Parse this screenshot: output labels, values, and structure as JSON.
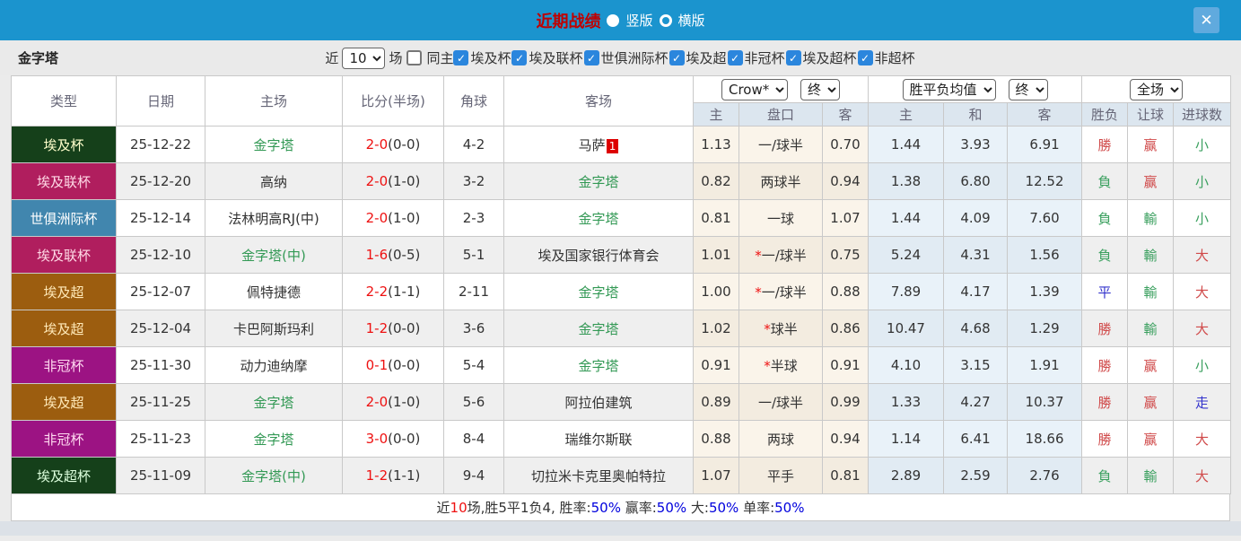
{
  "colors": {
    "titlebar_blue": "#1b94ce",
    "close_button_blue": "#60aade",
    "title_red": "#c00000",
    "header_cell_bg": "#dce6ef",
    "handicap_tint": "#faf4ea",
    "odds_tint": "#e9f2f9",
    "team_green": "#339955",
    "score_red": "#ee1111",
    "result_red": "#d04a4a",
    "result_green": "#3ba05f",
    "result_blue": "#3333cc",
    "footer_blue": "#0000dd",
    "badge_red": "#dd0000",
    "checkbox_blue": "#2b86dd"
  },
  "icons": {
    "close_glyph": "✕",
    "check_glyph": "✓",
    "star_glyph": "*"
  },
  "titlebar": {
    "title": "近期战绩",
    "radio_vertical": "竖版",
    "radio_horizontal": "横版"
  },
  "filters": {
    "team": "金字塔",
    "recent_label": "近",
    "recent_value": "10",
    "matches_label": "场",
    "same_venue_label": "同主",
    "leagues": [
      "埃及杯",
      "埃及联杯",
      "世俱洲际杯",
      "埃及超",
      "非冠杯",
      "埃及超杯",
      "非超杯"
    ]
  },
  "table": {
    "selects": {
      "odds_source": "Crow*",
      "odds_time": "终",
      "wdl_source": "胜平负均值",
      "wdl_time": "终",
      "scope": "全场"
    },
    "headers": {
      "type": "类型",
      "date": "日期",
      "home": "主场",
      "score": "比分(半场)",
      "corner": "角球",
      "away": "客场",
      "ah_home": "主",
      "ah_line": "盘口",
      "ah_away": "客",
      "eu_home": "主",
      "eu_draw": "和",
      "eu_away": "客",
      "result": "胜负",
      "handicap": "让球",
      "goals": "进球数"
    },
    "rows": [
      {
        "type": "埃及杯",
        "type_bg": "#15401a",
        "type_color": "#ffffcc",
        "date": "25-12-22",
        "home": "金字塔",
        "home_green": true,
        "score": "2-0",
        "half": "(0-0)",
        "corner": "4-2",
        "away": "马萨",
        "away_green": false,
        "away_badge": "1",
        "ah_home": "1.13",
        "ah_star": false,
        "ah_line": "一/球半",
        "ah_away": "0.70",
        "eu_home": "1.44",
        "eu_draw": "3.93",
        "eu_away": "6.91",
        "result": "勝",
        "result_color": "red",
        "handicap_result": "赢",
        "handicap_color": "red",
        "goals": "小",
        "goals_color": "green"
      },
      {
        "type": "埃及联杯",
        "type_bg": "#b01e5e",
        "type_color": "#ffd9e6",
        "date": "25-12-20",
        "home": "高纳",
        "home_green": false,
        "score": "2-0",
        "half": "(1-0)",
        "corner": "3-2",
        "away": "金字塔",
        "away_green": true,
        "ah_home": "0.82",
        "ah_star": false,
        "ah_line": "两球半",
        "ah_away": "0.94",
        "eu_home": "1.38",
        "eu_draw": "6.80",
        "eu_away": "12.52",
        "result": "負",
        "result_color": "green",
        "handicap_result": "赢",
        "handicap_color": "red",
        "goals": "小",
        "goals_color": "green"
      },
      {
        "type": "世俱洲际杯",
        "type_bg": "#4186ae",
        "type_color": "#ffffff",
        "date": "25-12-14",
        "home": "法林明高RJ(中)",
        "home_green": false,
        "score": "2-0",
        "half": "(1-0)",
        "corner": "2-3",
        "away": "金字塔",
        "away_green": true,
        "ah_home": "0.81",
        "ah_star": false,
        "ah_line": "一球",
        "ah_away": "1.07",
        "eu_home": "1.44",
        "eu_draw": "4.09",
        "eu_away": "7.60",
        "result": "負",
        "result_color": "green",
        "handicap_result": "輸",
        "handicap_color": "green",
        "goals": "小",
        "goals_color": "green"
      },
      {
        "type": "埃及联杯",
        "type_bg": "#b01e5e",
        "type_color": "#ffd9e6",
        "date": "25-12-10",
        "home": "金字塔(中)",
        "home_green": true,
        "score": "1-6",
        "half": "(0-5)",
        "corner": "5-1",
        "away": "埃及国家银行体育会",
        "away_green": false,
        "ah_home": "1.01",
        "ah_star": true,
        "ah_line": "一/球半",
        "ah_away": "0.75",
        "eu_home": "5.24",
        "eu_draw": "4.31",
        "eu_away": "1.56",
        "result": "負",
        "result_color": "green",
        "handicap_result": "輸",
        "handicap_color": "green",
        "goals": "大",
        "goals_color": "red"
      },
      {
        "type": "埃及超",
        "type_bg": "#9c5d0f",
        "type_color": "#ffe9b8",
        "date": "25-12-07",
        "home": "佩特捷德",
        "home_green": false,
        "score": "2-2",
        "half": "(1-1)",
        "corner": "2-11",
        "away": "金字塔",
        "away_green": true,
        "ah_home": "1.00",
        "ah_star": true,
        "ah_line": "一/球半",
        "ah_away": "0.88",
        "eu_home": "7.89",
        "eu_draw": "4.17",
        "eu_away": "1.39",
        "result": "平",
        "result_color": "blue",
        "handicap_result": "輸",
        "handicap_color": "green",
        "goals": "大",
        "goals_color": "red"
      },
      {
        "type": "埃及超",
        "type_bg": "#9c5d0f",
        "type_color": "#ffe9b8",
        "date": "25-12-04",
        "home": "卡巴阿斯玛利",
        "home_green": false,
        "score": "1-2",
        "half": "(0-0)",
        "corner": "3-6",
        "away": "金字塔",
        "away_green": true,
        "ah_home": "1.02",
        "ah_star": true,
        "ah_line": "球半",
        "ah_away": "0.86",
        "eu_home": "10.47",
        "eu_draw": "4.68",
        "eu_away": "1.29",
        "result": "勝",
        "result_color": "red",
        "handicap_result": "輸",
        "handicap_color": "green",
        "goals": "大",
        "goals_color": "red"
      },
      {
        "type": "非冠杯",
        "type_bg": "#9c1383",
        "type_color": "#ffd9f0",
        "date": "25-11-30",
        "home": "动力迪纳摩",
        "home_green": false,
        "score": "0-1",
        "half": "(0-0)",
        "corner": "5-4",
        "away": "金字塔",
        "away_green": true,
        "ah_home": "0.91",
        "ah_star": true,
        "ah_line": "半球",
        "ah_away": "0.91",
        "eu_home": "4.10",
        "eu_draw": "3.15",
        "eu_away": "1.91",
        "result": "勝",
        "result_color": "red",
        "handicap_result": "赢",
        "handicap_color": "red",
        "goals": "小",
        "goals_color": "green"
      },
      {
        "type": "埃及超",
        "type_bg": "#9c5d0f",
        "type_color": "#ffe9b8",
        "date": "25-11-25",
        "home": "金字塔",
        "home_green": true,
        "score": "2-0",
        "half": "(1-0)",
        "corner": "5-6",
        "away": "阿拉伯建筑",
        "away_green": false,
        "ah_home": "0.89",
        "ah_star": false,
        "ah_line": "一/球半",
        "ah_away": "0.99",
        "eu_home": "1.33",
        "eu_draw": "4.27",
        "eu_away": "10.37",
        "result": "勝",
        "result_color": "red",
        "handicap_result": "赢",
        "handicap_color": "red",
        "goals": "走",
        "goals_color": "blue"
      },
      {
        "type": "非冠杯",
        "type_bg": "#9c1383",
        "type_color": "#ffd9f0",
        "date": "25-11-23",
        "home": "金字塔",
        "home_green": true,
        "score": "3-0",
        "half": "(0-0)",
        "corner": "8-4",
        "away": "瑞维尔斯联",
        "away_green": false,
        "ah_home": "0.88",
        "ah_star": false,
        "ah_line": "两球",
        "ah_away": "0.94",
        "eu_home": "1.14",
        "eu_draw": "6.41",
        "eu_away": "18.66",
        "result": "勝",
        "result_color": "red",
        "handicap_result": "赢",
        "handicap_color": "red",
        "goals": "大",
        "goals_color": "red"
      },
      {
        "type": "埃及超杯",
        "type_bg": "#15401a",
        "type_color": "#ddffdd",
        "date": "25-11-09",
        "home": "金字塔(中)",
        "home_green": true,
        "score": "1-2",
        "half": "(1-1)",
        "corner": "9-4",
        "away": "切拉米卡克里奥帕特拉",
        "away_green": false,
        "ah_home": "1.07",
        "ah_star": false,
        "ah_line": "平手",
        "ah_away": "0.81",
        "eu_home": "2.89",
        "eu_draw": "2.59",
        "eu_away": "2.76",
        "result": "負",
        "result_color": "green",
        "handicap_result": "輸",
        "handicap_color": "green",
        "goals": "大",
        "goals_color": "red"
      }
    ]
  },
  "footer": {
    "segments": [
      {
        "text": "近",
        "color": "black"
      },
      {
        "text": "10",
        "color": "red"
      },
      {
        "text": "场,胜5平1负4, 胜率:",
        "color": "black"
      },
      {
        "text": "50%",
        "color": "blue"
      },
      {
        "text": " 赢率:",
        "color": "black"
      },
      {
        "text": "50%",
        "color": "blue"
      },
      {
        "text": " 大:",
        "color": "black"
      },
      {
        "text": "50%",
        "color": "blue"
      },
      {
        "text": " 单率:",
        "color": "black"
      },
      {
        "text": "50%",
        "color": "blue"
      }
    ]
  }
}
